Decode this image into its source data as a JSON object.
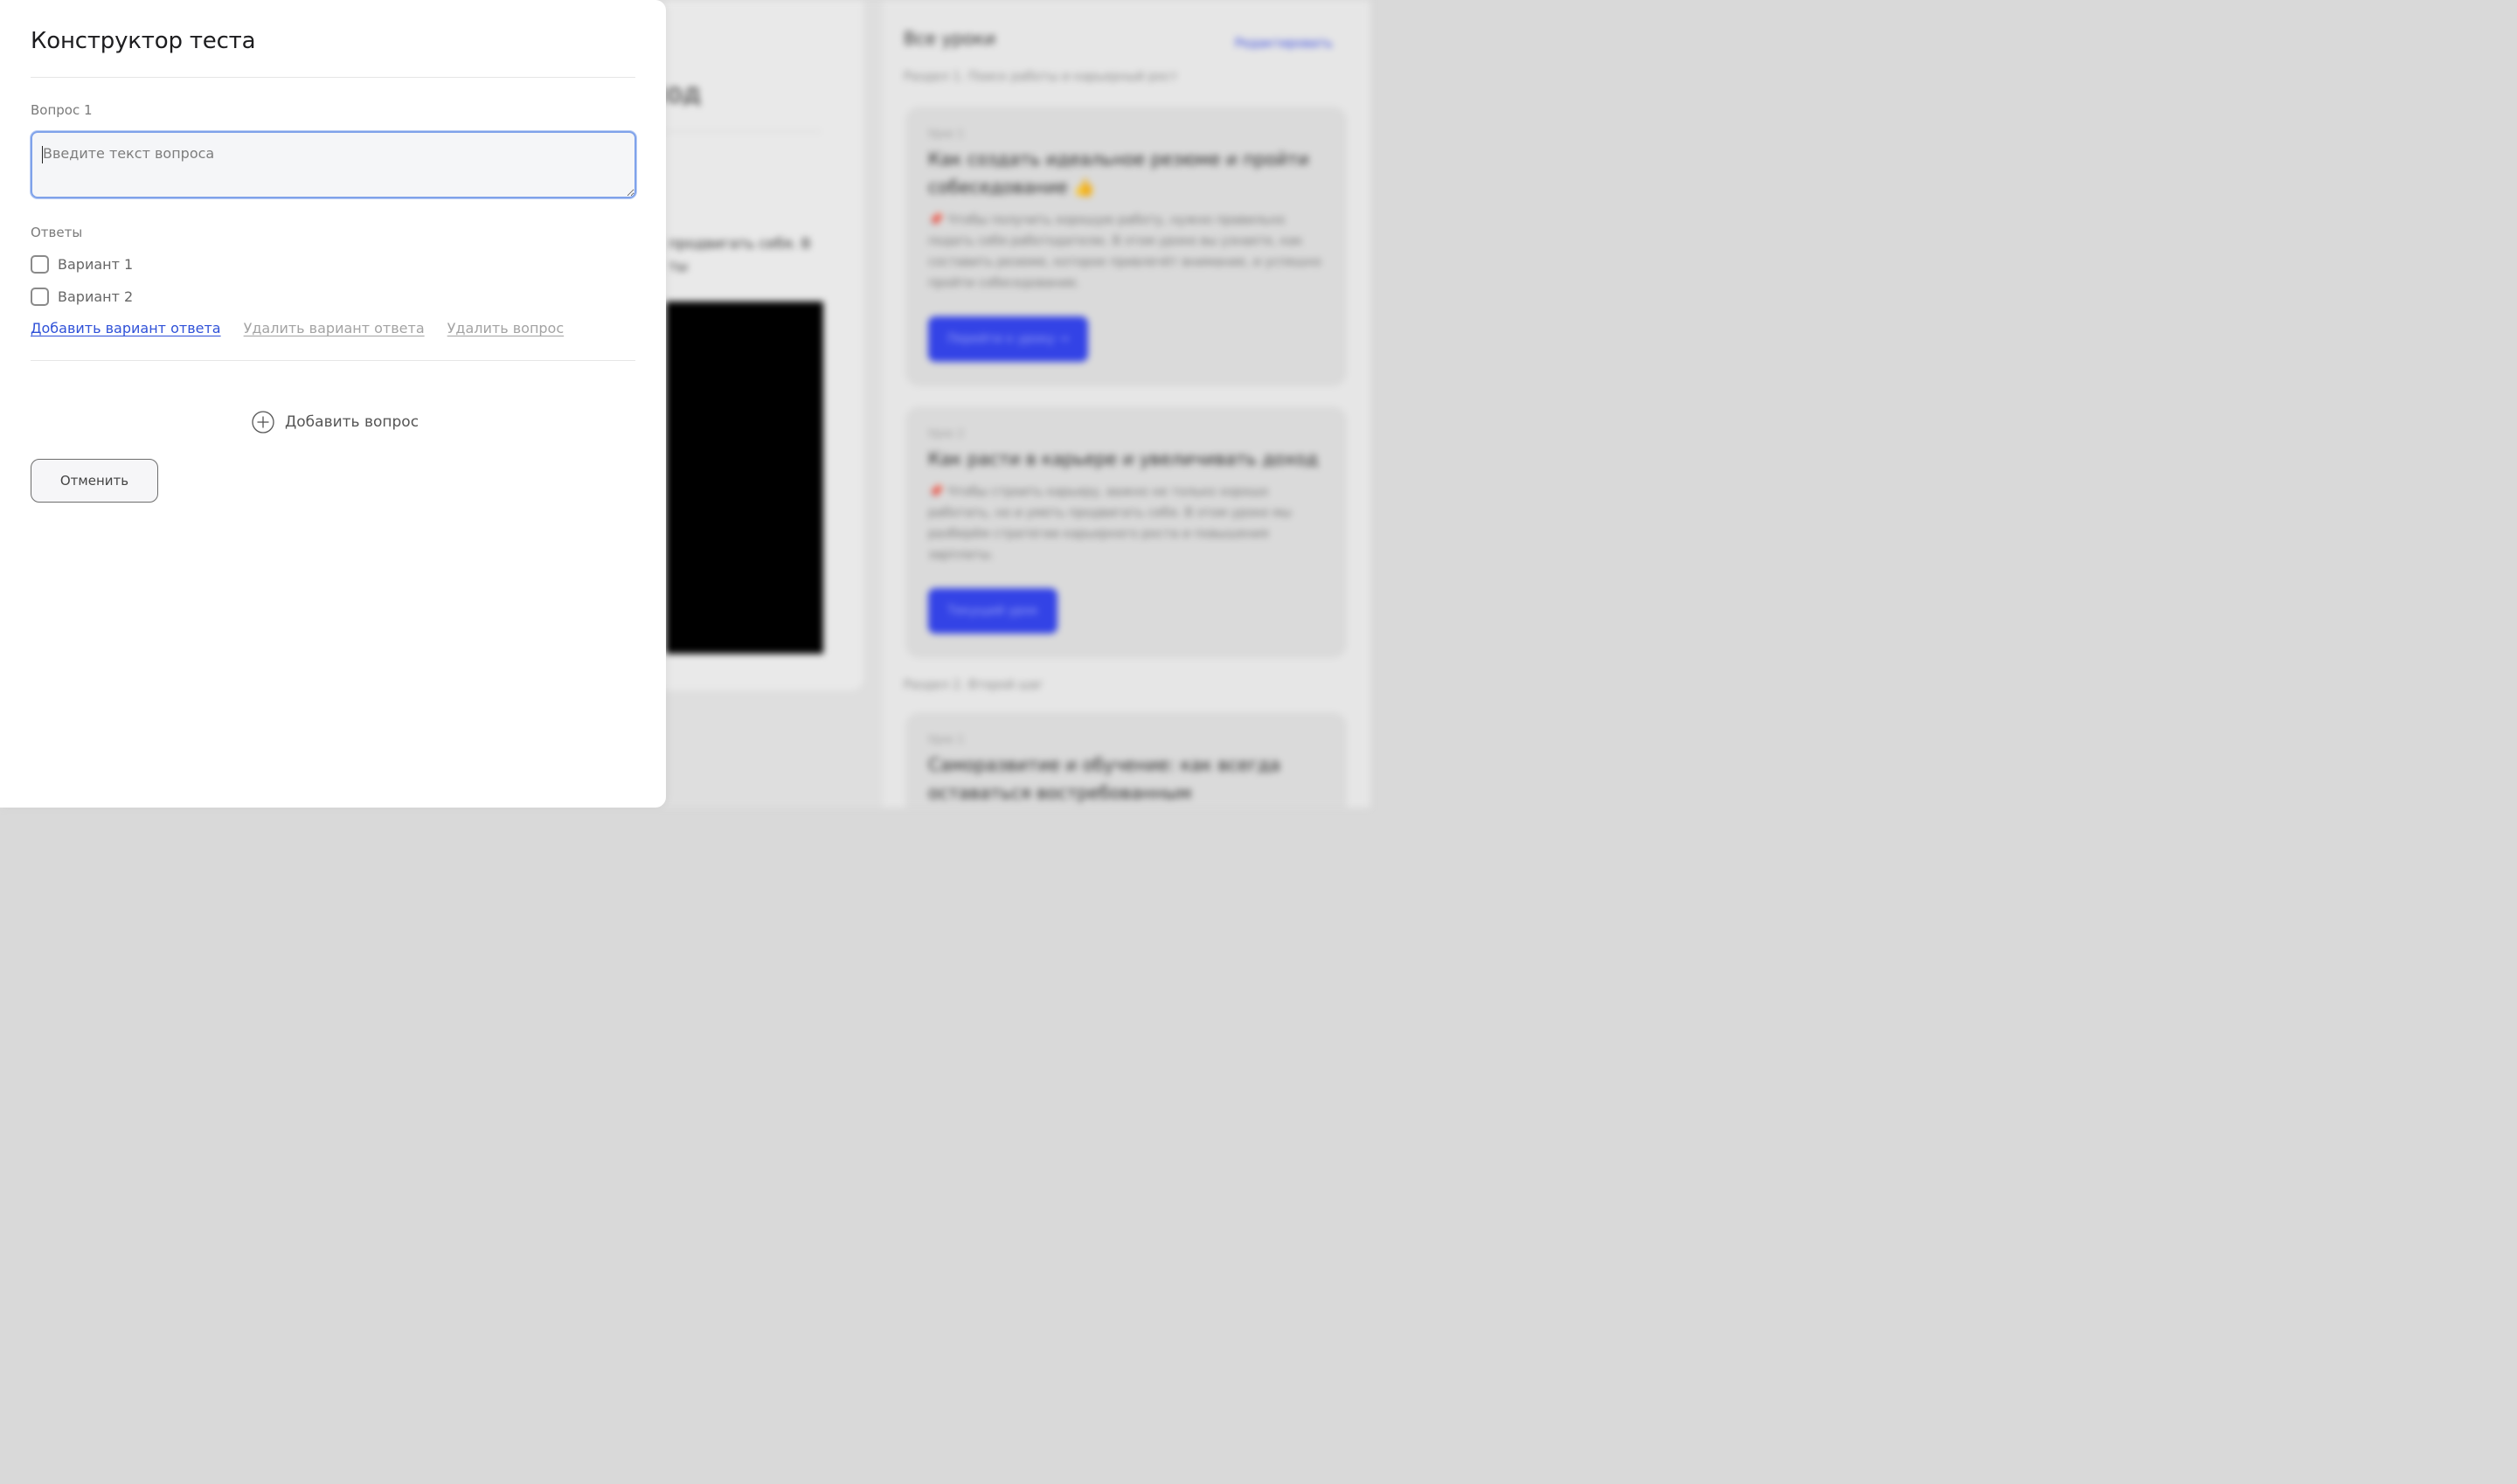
{
  "background": {
    "main_title": "ход",
    "main_text": "продвигать себя. В ты",
    "side_title": "Все уроки",
    "side_link": "Редактировать",
    "sections": [
      "Раздел 1. Поиск работы и карьерный рост",
      "Раздел 2. Второй шаг"
    ],
    "cards": [
      {
        "step": "Урок 1",
        "title": "Как создать идеальное резюме и пройти собеседование 👍",
        "desc": "📌 Чтобы получить хорошую работу, нужно правильно подать себя работодателю. В этом уроке вы узнаете, как составить резюме, которое привлечёт внимание, и успешно пройти собеседование.",
        "button": "Перейти к уроку →"
      },
      {
        "step": "Урок 2",
        "title": "Как расти в карьере и увеличивать доход",
        "desc": "📌 Чтобы строить карьеру, важно не только хорошо работать, но и уметь продвигать себя. В этом уроке мы разберём стратегии карьерного роста и повышения зарплаты.",
        "button": "Текущий урок"
      },
      {
        "step": "Урок 1",
        "title": "Саморазвитие и обучение: как всегда оставаться востребованным",
        "desc": "",
        "button": ""
      }
    ]
  },
  "modal": {
    "title": "Конструктор теста",
    "question_label": "Вопрос 1",
    "question_placeholder": "Введите текст вопроса",
    "answers_label": "Ответы",
    "answers": [
      "Вариант 1",
      "Вариант 2"
    ],
    "add_answer": "Добавить вариант ответа",
    "remove_answer": "Удалить вариант ответа",
    "remove_question": "Удалить вопрос",
    "add_question": "Добавить вопрос",
    "cancel": "Отменить"
  },
  "colors": {
    "link_primary": "#2f51d8",
    "link_muted": "#a3a3a3",
    "input_focus": "#7fa2ea",
    "bg_button": "#3343e6"
  }
}
